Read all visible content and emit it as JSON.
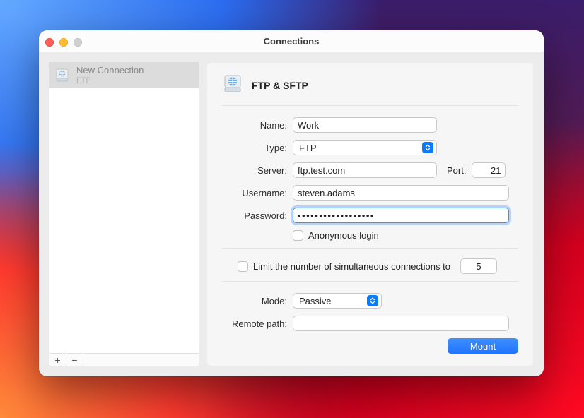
{
  "window": {
    "title": "Connections"
  },
  "sidebar": {
    "items": [
      {
        "label": "New Connection",
        "sublabel": "FTP"
      }
    ],
    "add_symbol": "+",
    "remove_symbol": "−"
  },
  "pane": {
    "header_title": "FTP & SFTP"
  },
  "form": {
    "labels": {
      "name": "Name:",
      "type": "Type:",
      "server": "Server:",
      "port": "Port:",
      "username": "Username:",
      "password": "Password:",
      "anonymous": "Anonymous login",
      "limit": "Limit the number of simultaneous connections to",
      "mode": "Mode:",
      "remote_path": "Remote path:"
    },
    "values": {
      "name": "Work",
      "type": "FTP",
      "server": "ftp.test.com",
      "port": "21",
      "username": "steven.adams",
      "password": "••••••••••••••••••",
      "anonymous_checked": false,
      "limit_checked": false,
      "limit_value": "5",
      "mode": "Passive",
      "remote_path": ""
    }
  },
  "actions": {
    "mount": "Mount"
  }
}
